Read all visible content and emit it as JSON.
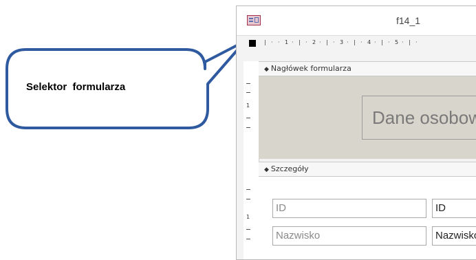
{
  "callout": {
    "text": "Selektor  formularza"
  },
  "window": {
    "title": "f14_1",
    "app_icon": "form-icon"
  },
  "ruler": {
    "horizontal_marks": [
      "1",
      "2",
      "3",
      "4",
      "5"
    ],
    "vertical_marks_header": [
      "1"
    ],
    "vertical_marks_detail": [
      "1"
    ]
  },
  "sections": {
    "header": {
      "label": "Nagłówek formularza",
      "title_text": "Dane osobowe"
    },
    "detail": {
      "label": "Szczegóły"
    }
  },
  "fields": [
    {
      "label": "ID",
      "value": "ID"
    },
    {
      "label": "Nazwisko",
      "value": "Nazwisko"
    }
  ],
  "colors": {
    "callout_fill": "#2f5aa0",
    "header_background": "#d8d5cd",
    "form_icon_border": "#a0324a"
  }
}
